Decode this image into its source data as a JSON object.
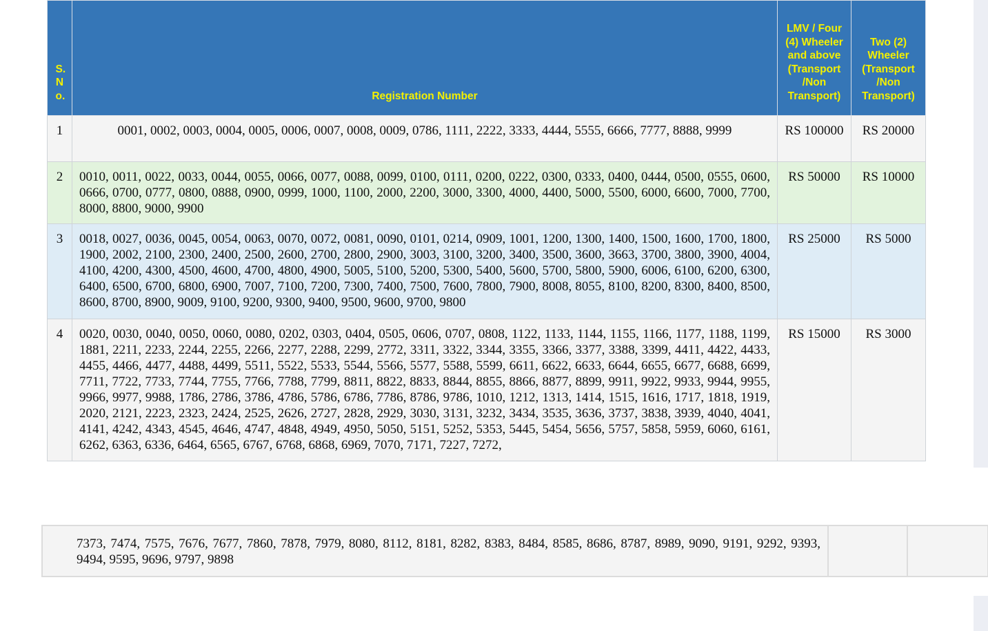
{
  "table": {
    "headers": {
      "sno": "S.No.",
      "registration": "Registration Number",
      "four_wheeler": "LMV / Four (4) Wheeler and above (Transport /Non Transport)",
      "two_wheeler": "Two (2) Wheeler (Transport /Non Transport)"
    },
    "rows": [
      {
        "sno": "1",
        "numbers": "0001, 0002, 0003, 0004, 0005, 0006, 0007, 0008, 0009, 0786, 1111, 2222, 3333, 4444, 5555, 6666, 7777, 8888, 9999",
        "four_wheeler_fee": "RS 100000",
        "two_wheeler_fee": "RS 20000"
      },
      {
        "sno": "2",
        "numbers": "0010, 0011, 0022, 0033, 0044, 0055, 0066, 0077, 0088, 0099, 0100, 0111, 0200, 0222, 0300, 0333, 0400, 0444, 0500, 0555, 0600, 0666, 0700, 0777, 0800, 0888, 0900, 0999, 1000, 1100, 2000, 2200, 3000, 3300, 4000, 4400, 5000, 5500, 6000, 6600, 7000, 7700, 8000, 8800, 9000, 9900",
        "four_wheeler_fee": "RS 50000",
        "two_wheeler_fee": "RS 10000"
      },
      {
        "sno": "3",
        "numbers": "0018, 0027, 0036, 0045, 0054, 0063, 0070, 0072, 0081, 0090, 0101, 0214, 0909, 1001, 1200, 1300, 1400, 1500, 1600, 1700, 1800, 1900, 2002, 2100, 2300, 2400, 2500, 2600, 2700, 2800, 2900, 3003, 3100, 3200, 3400, 3500, 3600, 3663, 3700, 3800, 3900, 4004, 4100, 4200, 4300, 4500, 4600, 4700, 4800, 4900, 5005, 5100, 5200, 5300, 5400, 5600, 5700, 5800, 5900, 6006, 6100, 6200, 6300, 6400, 6500, 6700, 6800, 6900, 7007, 7100, 7200, 7300, 7400, 7500, 7600, 7800, 7900, 8008, 8055, 8100, 8200, 8300, 8400, 8500, 8600, 8700, 8900, 9009, 9100, 9200, 9300, 9400, 9500, 9600, 9700, 9800",
        "four_wheeler_fee": "RS 25000",
        "two_wheeler_fee": "RS 5000"
      },
      {
        "sno": "4",
        "numbers": "0020, 0030, 0040, 0050, 0060, 0080, 0202, 0303, 0404, 0505, 0606, 0707, 0808, 1122, 1133, 1144, 1155, 1166, 1177, 1188, 1199, 1881, 2211, 2233, 2244, 2255, 2266, 2277, 2288, 2299, 2772, 3311, 3322, 3344, 3355, 3366, 3377, 3388, 3399, 4411, 4422, 4433, 4455, 4466, 4477, 4488, 4499, 5511, 5522, 5533, 5544, 5566, 5577, 5588, 5599, 6611, 6622, 6633, 6644, 6655, 6677, 6688, 6699, 7711, 7722, 7733, 7744, 7755, 7766, 7788, 7799, 8811, 8822, 8833, 8844, 8855, 8866, 8877, 8899, 9911, 9922, 9933, 9944, 9955, 9966, 9977, 9988, 1786, 2786, 3786, 4786, 5786, 6786, 7786, 8786, 9786, 1010, 1212, 1313, 1414, 1515, 1616, 1717, 1818, 1919, 2020, 2121, 2223, 2323, 2424, 2525, 2626, 2727, 2828, 2929, 3030, 3131, 3232, 3434, 3535, 3636, 3737, 3838, 3939, 4040, 4041, 4141, 4242, 4343, 4545, 4646, 4747, 4848, 4949, 4950, 5050, 5151, 5252, 5353, 5445, 5454, 5656, 5757, 5858, 5959, 6060, 6161, 6262, 6363, 6336, 6464, 6565, 6767, 6768, 6868, 6969, 7070, 7171, 7227, 7272,",
        "four_wheeler_fee": "RS 15000",
        "two_wheeler_fee": "RS 3000"
      }
    ]
  },
  "continuation": {
    "numbers": "7373, 7474, 7575, 7676, 7677, 7860, 7878, 7979, 8080, 8112, 8181, 8282, 8383, 8484, 8585, 8686, 8787, 8989, 9090, 9191, 9292, 9393, 9494, 9595, 9696, 9797, 9898"
  }
}
